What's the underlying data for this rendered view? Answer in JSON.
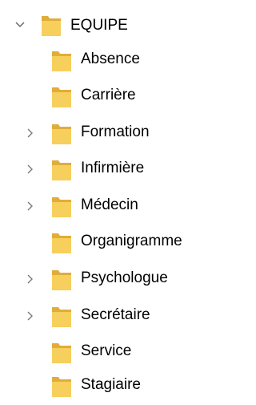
{
  "colors": {
    "folder_back": "#e0ad3a",
    "folder_front": "#f6cf5d",
    "chevron": "#7a7a7a",
    "text": "#000000",
    "background": "#ffffff"
  },
  "tree": {
    "root": {
      "label": "EQUIPE",
      "icon": "folder-icon",
      "expanded": true
    },
    "children": [
      {
        "label": "Absence",
        "icon": "folder-icon",
        "has_children": false
      },
      {
        "label": "Carrière",
        "icon": "folder-icon",
        "has_children": false
      },
      {
        "label": "Formation",
        "icon": "folder-icon",
        "has_children": true
      },
      {
        "label": "Infirmière",
        "icon": "folder-icon",
        "has_children": true
      },
      {
        "label": "Médecin",
        "icon": "folder-icon",
        "has_children": true
      },
      {
        "label": "Organigramme",
        "icon": "folder-icon",
        "has_children": false
      },
      {
        "label": "Psychologue",
        "icon": "folder-icon",
        "has_children": true
      },
      {
        "label": "Secrétaire",
        "icon": "folder-icon",
        "has_children": true
      },
      {
        "label": "Service",
        "icon": "folder-icon",
        "has_children": false
      },
      {
        "label": "Stagiaire",
        "icon": "folder-icon",
        "has_children": false
      }
    ]
  }
}
